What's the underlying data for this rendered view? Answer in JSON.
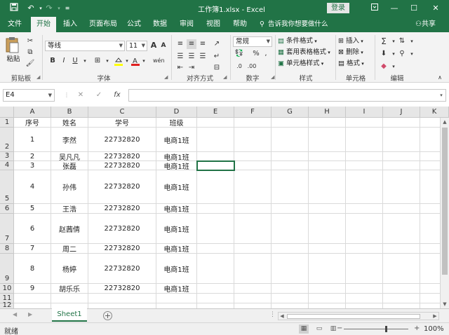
{
  "titlebar": {
    "title": "工作簿1.xlsx  -  Excel",
    "login": "登录",
    "icons": [
      "save-icon",
      "undo-icon",
      "redo-icon",
      "customize-icon"
    ]
  },
  "tabs": [
    "文件",
    "开始",
    "插入",
    "页面布局",
    "公式",
    "数据",
    "审阅",
    "视图",
    "帮助"
  ],
  "active_tab": "开始",
  "tell_me": "告诉我你想要做什么",
  "share": "共享",
  "ribbon": {
    "clipboard": {
      "label": "剪贴板",
      "paste": "粘贴"
    },
    "font": {
      "label": "字体",
      "name": "等线",
      "size": "11"
    },
    "alignment": {
      "label": "对齐方式"
    },
    "number": {
      "label": "数字",
      "format": "常规",
      "percent": "%"
    },
    "styles": {
      "label": "样式",
      "conditional": "条件格式",
      "table": "套用表格格式",
      "cell": "单元格样式"
    },
    "cells": {
      "label": "单元格",
      "insert": "插入",
      "delete": "删除",
      "format": "格式"
    },
    "editing": {
      "label": "编辑"
    }
  },
  "formula_bar": {
    "name_box": "E4",
    "fx": "fx",
    "formula": ""
  },
  "columns": [
    "A",
    "B",
    "C",
    "D",
    "E",
    "F",
    "G",
    "H",
    "I",
    "J",
    "K"
  ],
  "rows": [
    {
      "n": "1",
      "cells": [
        "序号",
        "姓名",
        "学号",
        "班级"
      ]
    },
    {
      "n": "2",
      "cells": [
        "1",
        "李然",
        "22732820",
        "电商1班"
      ]
    },
    {
      "n": "3",
      "cells": [
        "2",
        "吴凡凡",
        "22732820",
        "电商1班"
      ]
    },
    {
      "n": "4",
      "cells": [
        "3",
        "张磊",
        "22732820",
        "电商1班"
      ]
    },
    {
      "n": "5",
      "cells": [
        "4",
        "孙伟",
        "22732820",
        "电商1班"
      ]
    },
    {
      "n": "6",
      "cells": [
        "5",
        "王浩",
        "22732820",
        "电商1班"
      ]
    },
    {
      "n": "7",
      "cells": [
        "6",
        "赵茜倩",
        "22732820",
        "电商1班"
      ]
    },
    {
      "n": "8",
      "cells": [
        "7",
        "周二",
        "22732820",
        "电商1班"
      ]
    },
    {
      "n": "9",
      "cells": [
        "8",
        "杨婷",
        "22732820",
        "电商1班"
      ]
    },
    {
      "n": "10",
      "cells": [
        "9",
        "胡乐乐",
        "22732820",
        "电商1班"
      ]
    },
    {
      "n": "11",
      "cells": [
        "",
        "",
        "",
        ""
      ]
    },
    {
      "n": "12",
      "cells": [
        "",
        "",
        "",
        ""
      ]
    }
  ],
  "sheet_tab": "Sheet1",
  "status": {
    "text": "就绪",
    "zoom": "100%"
  },
  "colors": {
    "accent": "#217346"
  }
}
